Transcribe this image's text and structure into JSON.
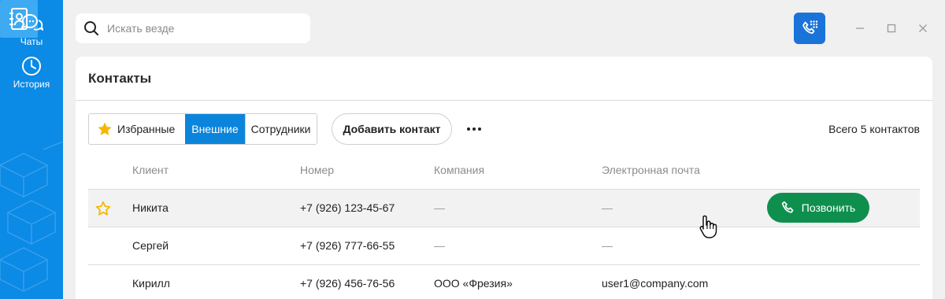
{
  "sidebar": {
    "items": [
      {
        "label": "Чаты",
        "icon": "chat-bubbles-icon"
      },
      {
        "label": "История",
        "icon": "clock-icon"
      },
      {
        "label": "",
        "icon": "contact-book-icon"
      }
    ],
    "bg_color": "#0b8ae6",
    "active_color": "#3eaaf2"
  },
  "search": {
    "placeholder": "Искать везде",
    "value": ""
  },
  "page": {
    "title": "Контакты",
    "tabs": [
      {
        "label": "Избранные",
        "icon": "star-icon",
        "active": false
      },
      {
        "label": "Внешние",
        "active": true
      },
      {
        "label": "Сотрудники",
        "active": false
      }
    ],
    "add_contact_label": "Добавить контакт",
    "total_label": "Всего 5 контактов"
  },
  "table": {
    "headers": [
      "Клиент",
      "Номер",
      "Компания",
      "Электронная почта"
    ],
    "rows": [
      {
        "favorite": true,
        "name": "Никита",
        "phone": "+7 (926) 123-45-67",
        "company": "—",
        "email": "—",
        "call_label": "Позвонить",
        "highlighted": true
      },
      {
        "favorite": false,
        "name": "Сергей",
        "phone": "+7 (926) 777-66-55",
        "company": "—",
        "email": "—"
      },
      {
        "favorite": false,
        "name": "Кирилл",
        "phone": "+7 (926) 456-76-56",
        "company": "ООО «Фрезия»",
        "email": "user1@company.com"
      }
    ]
  },
  "colors": {
    "accent": "#0b85dc",
    "call_button": "#0f8f4e",
    "star": "#f5b800",
    "dial_button": "#1a73d9"
  }
}
